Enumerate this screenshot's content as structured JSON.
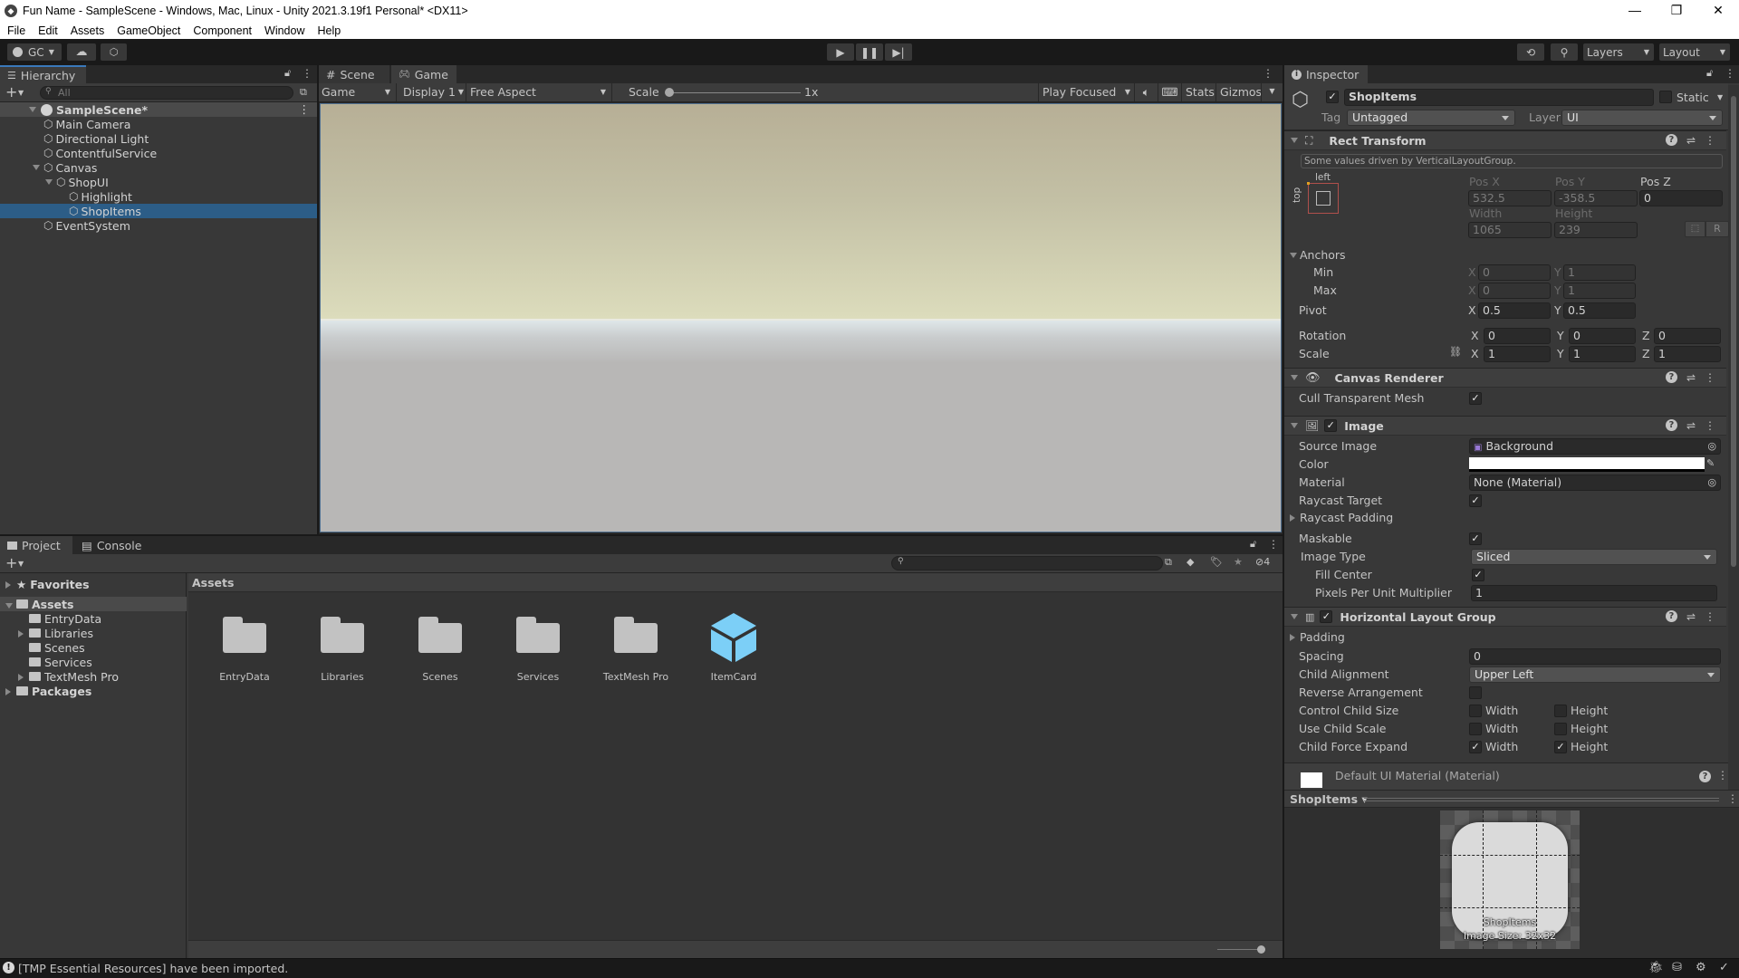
{
  "window": {
    "title": "Fun Name - SampleScene - Windows, Mac, Linux - Unity 2021.3.19f1 Personal* <DX11>",
    "controls": [
      "minimize",
      "maximize",
      "close"
    ]
  },
  "menu": [
    "File",
    "Edit",
    "Assets",
    "GameObject",
    "Component",
    "Window",
    "Help"
  ],
  "toolbar": {
    "account_label": "GC",
    "layers_label": "Layers",
    "layout_label": "Layout"
  },
  "hierarchy": {
    "tab_label": "Hierarchy",
    "search_placeholder": "All",
    "scene_name": "SampleScene*",
    "items": [
      {
        "label": "Main Camera",
        "depth": 1,
        "expanded": null,
        "selected": false
      },
      {
        "label": "Directional Light",
        "depth": 1,
        "expanded": null,
        "selected": false
      },
      {
        "label": "ContentfulService",
        "depth": 1,
        "expanded": null,
        "selected": false
      },
      {
        "label": "Canvas",
        "depth": 1,
        "expanded": true,
        "selected": false
      },
      {
        "label": "ShopUI",
        "depth": 2,
        "expanded": true,
        "selected": false
      },
      {
        "label": "Highlight",
        "depth": 3,
        "expanded": null,
        "selected": false
      },
      {
        "label": "ShopItems",
        "depth": 3,
        "expanded": null,
        "selected": true
      },
      {
        "label": "EventSystem",
        "depth": 1,
        "expanded": null,
        "selected": false
      }
    ]
  },
  "game_view": {
    "tabs": [
      {
        "label": "Scene",
        "active": false
      },
      {
        "label": "Game",
        "active": true
      }
    ],
    "view_mode": "Game",
    "display": "Display 1",
    "aspect": "Free Aspect",
    "scale_label": "Scale",
    "scale_value": "1x",
    "play_mode": "Play Focused",
    "stats_label": "Stats",
    "gizmos_label": "Gizmos"
  },
  "project": {
    "tabs": [
      {
        "label": "Project",
        "active": true
      },
      {
        "label": "Console",
        "active": false
      }
    ],
    "hidden_count": "4",
    "tree": [
      {
        "label": "Favorites",
        "depth": 0,
        "bold": true,
        "arrow": "right",
        "kind": "star"
      },
      {
        "label": "Assets",
        "depth": 0,
        "bold": true,
        "arrow": "down",
        "kind": "folder-open",
        "selected": true
      },
      {
        "label": "EntryData",
        "depth": 1,
        "arrow": null,
        "kind": "folder"
      },
      {
        "label": "Libraries",
        "depth": 1,
        "arrow": "right",
        "kind": "folder"
      },
      {
        "label": "Scenes",
        "depth": 1,
        "arrow": null,
        "kind": "folder"
      },
      {
        "label": "Services",
        "depth": 1,
        "arrow": null,
        "kind": "folder"
      },
      {
        "label": "TextMesh Pro",
        "depth": 1,
        "arrow": "right",
        "kind": "folder"
      },
      {
        "label": "Packages",
        "depth": 0,
        "bold": true,
        "arrow": "right",
        "kind": "folder"
      }
    ],
    "breadcrumb": "Assets",
    "assets": [
      {
        "label": "EntryData",
        "kind": "folder"
      },
      {
        "label": "Libraries",
        "kind": "folder"
      },
      {
        "label": "Scenes",
        "kind": "folder"
      },
      {
        "label": "Services",
        "kind": "folder"
      },
      {
        "label": "TextMesh Pro",
        "kind": "folder"
      },
      {
        "label": "ItemCard",
        "kind": "prefab"
      }
    ]
  },
  "inspector": {
    "tab_label": "Inspector",
    "object_name": "ShopItems",
    "active": true,
    "static_label": "Static",
    "static": false,
    "tag_label": "Tag",
    "tag_value": "Untagged",
    "layer_label": "Layer",
    "layer_value": "UI",
    "rect_transform": {
      "title": "Rect Transform",
      "notice": "Some values driven by VerticalLayoutGroup.",
      "anchor_h": "left",
      "anchor_v": "top",
      "pos_x_label": "Pos X",
      "pos_x": "532.5",
      "pos_y_label": "Pos Y",
      "pos_y": "-358.5",
      "pos_z_label": "Pos Z",
      "pos_z": "0",
      "width_label": "Width",
      "width": "1065",
      "height_label": "Height",
      "height": "239",
      "anchors_label": "Anchors",
      "min_label": "Min",
      "min_x": "0",
      "min_y": "1",
      "max_label": "Max",
      "max_x": "0",
      "max_y": "1",
      "pivot_label": "Pivot",
      "pivot_x": "0.5",
      "pivot_y": "0.5",
      "rotation_label": "Rotation",
      "rot_x": "0",
      "rot_y": "0",
      "rot_z": "0",
      "scale_label": "Scale",
      "scale_x": "1",
      "scale_y": "1",
      "scale_z": "1",
      "r_button": "R"
    },
    "canvas_renderer": {
      "title": "Canvas Renderer",
      "cull_label": "Cull Transparent Mesh",
      "cull": true
    },
    "image": {
      "title": "Image",
      "enabled": true,
      "source_label": "Source Image",
      "source_value": "Background",
      "color_label": "Color",
      "color_value": "#ffffff",
      "material_label": "Material",
      "material_value": "None (Material)",
      "raycast_label": "Raycast Target",
      "raycast": true,
      "raycast_padding_label": "Raycast Padding",
      "maskable_label": "Maskable",
      "maskable": true,
      "type_label": "Image Type",
      "type_value": "Sliced",
      "fill_center_label": "Fill Center",
      "fill_center": true,
      "ppu_label": "Pixels Per Unit Multiplier",
      "ppu_value": "1"
    },
    "hlg": {
      "title": "Horizontal Layout Group",
      "enabled": true,
      "padding_label": "Padding",
      "spacing_label": "Spacing",
      "spacing_value": "0",
      "alignment_label": "Child Alignment",
      "alignment_value": "Upper Left",
      "reverse_label": "Reverse Arrangement",
      "reverse": false,
      "control_label": "Control Child Size",
      "control_w": false,
      "control_h": false,
      "usescale_label": "Use Child Scale",
      "usescale_w": false,
      "usescale_h": false,
      "expand_label": "Child Force Expand",
      "expand_w": true,
      "expand_h": true,
      "width_label": "Width",
      "height_label": "Height"
    },
    "material": {
      "title": "Default UI Material (Material)"
    },
    "preview": {
      "object_label": "ShopItems",
      "name": "ShopItems",
      "size": "Image Size: 32x32"
    }
  },
  "status_bar": {
    "message": "[TMP Essential Resources] have been imported."
  },
  "colors": {
    "accent": "#3a79bb",
    "selection": "#2c5d87",
    "prefab_blue": "#7ccff7"
  }
}
